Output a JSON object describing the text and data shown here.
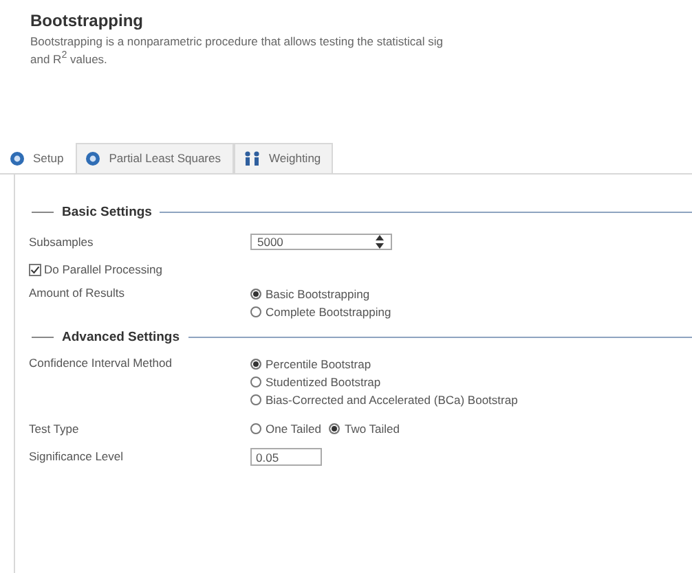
{
  "header": {
    "title": "Bootstrapping",
    "description": "Bootstrapping is a nonparametric procedure that allows testing the statistical sig",
    "description_2": "and R$^{2}$ values."
  },
  "tabs": [
    {
      "label": "Setup",
      "selected": true,
      "kind": "model"
    },
    {
      "label": "Partial Least Squares",
      "selected": false,
      "kind": "model"
    },
    {
      "label": "Weighting",
      "selected": false,
      "kind": "weighting"
    }
  ],
  "basic_settings": {
    "heading": "Basic Settings",
    "subsamples": {
      "label": "Subsamples",
      "value": "5000"
    },
    "parallel": {
      "label": "Do Parallel Processing",
      "checked": true
    },
    "amount": {
      "label": "Amount of Results",
      "options": [
        {
          "label": "Basic Bootstrapping",
          "selected": true
        },
        {
          "label": "Complete Bootstrapping",
          "selected": false
        }
      ]
    }
  },
  "advanced_settings": {
    "heading": "Advanced Settings",
    "ci_method": {
      "label": "Confidence Interval Method",
      "options": [
        {
          "label": "Percentile Bootstrap",
          "selected": true
        },
        {
          "label": "Studentized Bootstrap",
          "selected": false
        },
        {
          "label": "Bias-Corrected and Accelerated (BCa) Bootstrap",
          "selected": false
        }
      ]
    },
    "test_type": {
      "label": "Test Type",
      "options": [
        {
          "label": "One Tailed",
          "selected": false
        },
        {
          "label": "Two Tailed",
          "selected": true
        }
      ]
    },
    "significance": {
      "label": "Significance Level",
      "value": "0.05"
    }
  }
}
